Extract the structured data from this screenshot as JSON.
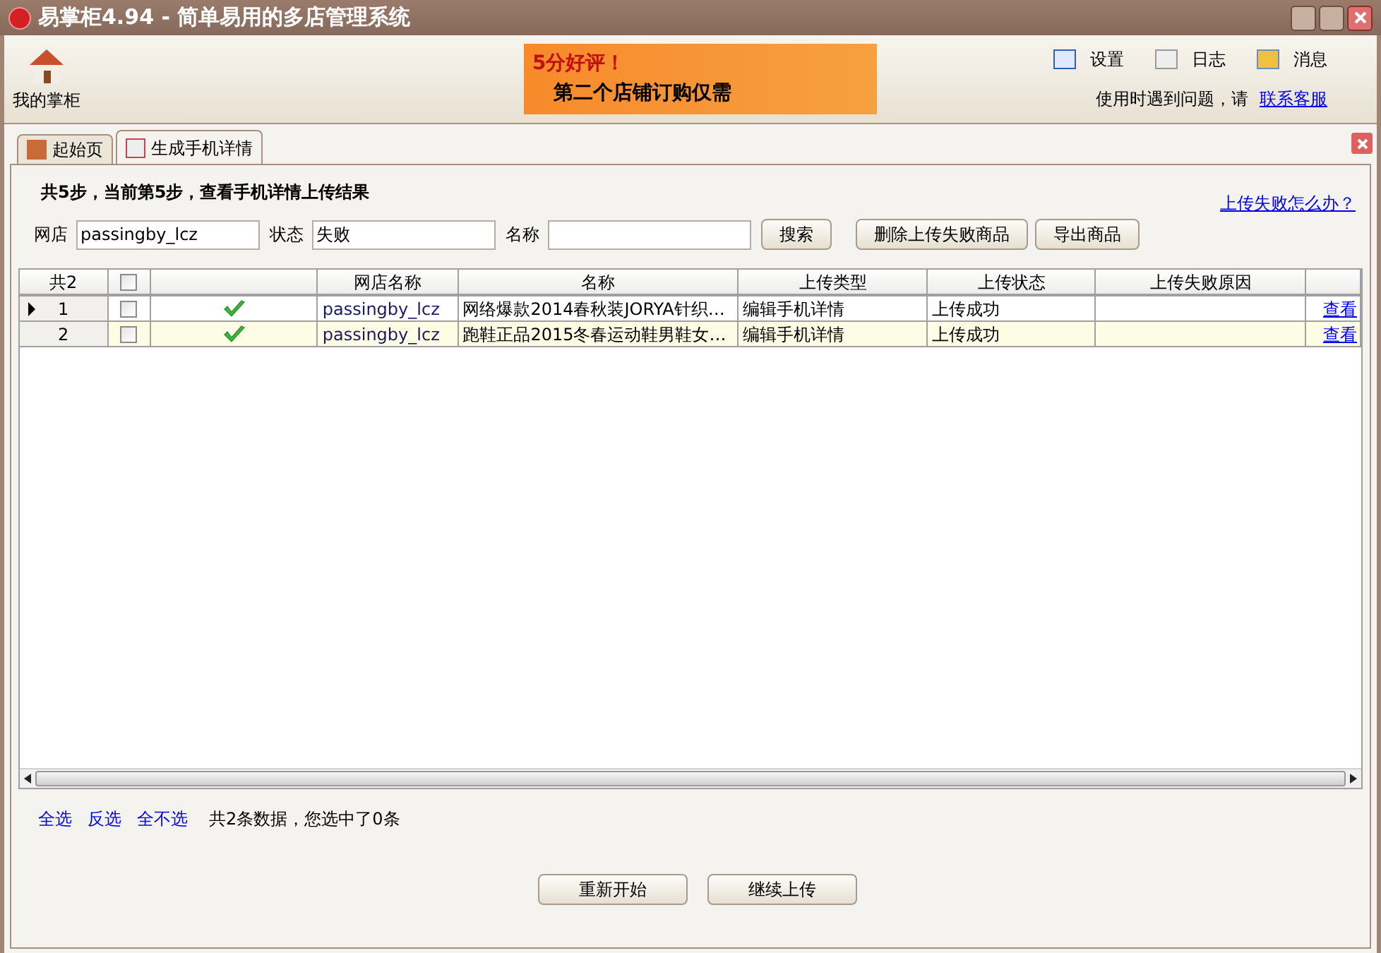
{
  "window": {
    "title": "易掌柜4.94 - 简单易用的多店管理系统"
  },
  "toolbar": {
    "home_label": "我的掌柜",
    "banner": {
      "headline": "5分好评！",
      "subline": "第二个店铺订购仅需"
    },
    "actions": [
      "设置",
      "日志",
      "消息"
    ],
    "help_text": "使用时遇到问题，请",
    "help_link": "联系客服"
  },
  "tabs": [
    {
      "label": "起始页",
      "selected": false
    },
    {
      "label": "生成手机详情",
      "selected": true
    }
  ],
  "step_text": "共5步，当前第5步，查看手机详情上传结果",
  "help_question": "上传失败怎么办？",
  "filters": [
    {
      "label": "网店",
      "value": "passingby_lcz"
    },
    {
      "label": "状态",
      "value": "失败"
    },
    {
      "label": "名称"
    }
  ],
  "buttons": [
    "搜索",
    "删除上传失败商品",
    "导出商品"
  ],
  "table": {
    "count_header": "共2",
    "all_checked": false,
    "columns": [
      "网店名称",
      "名称",
      "上传类型",
      "上传状态",
      "上传失败原因"
    ],
    "rows": [
      {
        "index": "1",
        "current": true,
        "checked": false,
        "ok": true,
        "shop": "passingby_lcz",
        "name": "网络爆款2014春秋装JORYA针织…",
        "type": "编辑手机详情",
        "state": "上传成功",
        "action": "查看"
      },
      {
        "index": "2",
        "current": false,
        "checked": false,
        "ok": true,
        "shop": "passingby_lcz",
        "name": "跑鞋正品2015冬春运动鞋男鞋女…",
        "type": "编辑手机详情",
        "state": "上传成功",
        "action": "查看"
      }
    ]
  },
  "selection_links": [
    "全选",
    "反选",
    "全不选"
  ],
  "summary": "共2条数据，您选中了0条",
  "footer_buttons": [
    "重新开始",
    "继续上传"
  ]
}
